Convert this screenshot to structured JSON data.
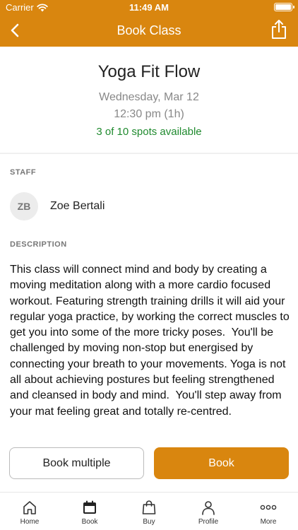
{
  "status_bar": {
    "carrier": "Carrier",
    "time": "11:49 AM",
    "wifi_icon": "wifi-icon",
    "battery_icon": "battery-icon",
    "battery_level": 1.0
  },
  "nav": {
    "title": "Book Class",
    "back_icon": "chevron-left-icon",
    "share_icon": "share-icon"
  },
  "class_info": {
    "title": "Yoga Fit Flow",
    "date": "Wednesday, Mar 12",
    "time": "12:30 pm (1h)",
    "spots": "3 of 10 spots available"
  },
  "staff": {
    "label": "STAFF",
    "initials": "ZB",
    "name": "Zoe Bertali"
  },
  "description": {
    "label": "DESCRIPTION",
    "text": "This class will connect mind and body by creating a moving meditation along with a more cardio focused workout. Featuring strength training drills it will aid your regular yoga practice, by working the correct muscles to get you into some of the more tricky poses.  You'll be challenged by moving non-stop but energised by connecting your breath to your movements. Yoga is not all about achieving postures but feeling strengthened and cleansed in body and mind.  You'll step away from your mat feeling great and totally re-centred."
  },
  "actions": {
    "book_multiple": "Book multiple",
    "book": "Book"
  },
  "tabs": [
    {
      "label": "Home",
      "icon": "home-icon"
    },
    {
      "label": "Book",
      "icon": "calendar-icon",
      "selected": true
    },
    {
      "label": "Buy",
      "icon": "shopping-bag-icon"
    },
    {
      "label": "Profile",
      "icon": "person-icon"
    },
    {
      "label": "More",
      "icon": "more-dots-icon"
    }
  ],
  "colors": {
    "accent": "#d9860f",
    "spots_green": "#1f8a2e",
    "muted_text": "#888888"
  }
}
